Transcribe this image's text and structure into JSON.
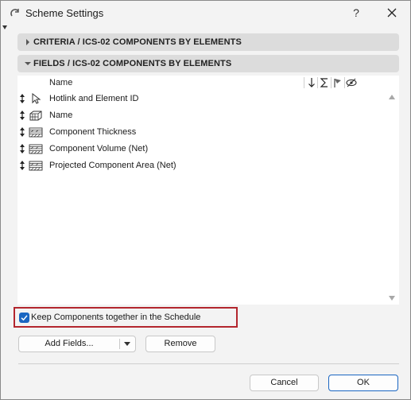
{
  "window": {
    "title": "Scheme Settings",
    "help_label": "?"
  },
  "criteria_section": {
    "label": "CRITERIA / ICS-02 COMPONENTS BY ELEMENTS",
    "expanded": false
  },
  "fields_section": {
    "label": "FIELDS / ICS-02 COMPONENTS BY ELEMENTS",
    "expanded": true
  },
  "field_list": {
    "column_header": "Name",
    "column_icons": [
      "sort-descending-icon",
      "sum-icon",
      "flag-icon",
      "hide-eye-icon"
    ],
    "rows": [
      {
        "label": "Hotlink and Element ID",
        "icon": "pointer-arrow-icon"
      },
      {
        "label": "Name",
        "icon": "element-box-icon"
      },
      {
        "label": "Component Thickness",
        "icon": "hatch-pattern-icon"
      },
      {
        "label": "Component Volume (Net)",
        "icon": "hatch-pattern-icon"
      },
      {
        "label": "Projected Component Area (Net)",
        "icon": "hatch-pattern-icon"
      }
    ]
  },
  "keep_components": {
    "label": "Keep Components together in the Schedule",
    "checked": true
  },
  "buttons": {
    "add_fields": "Add Fields...",
    "remove": "Remove",
    "cancel": "Cancel",
    "ok": "OK"
  },
  "colors": {
    "accent": "#1a66c2",
    "highlight_frame": "#b3262e",
    "section_header_bg": "#dcdcdc"
  }
}
